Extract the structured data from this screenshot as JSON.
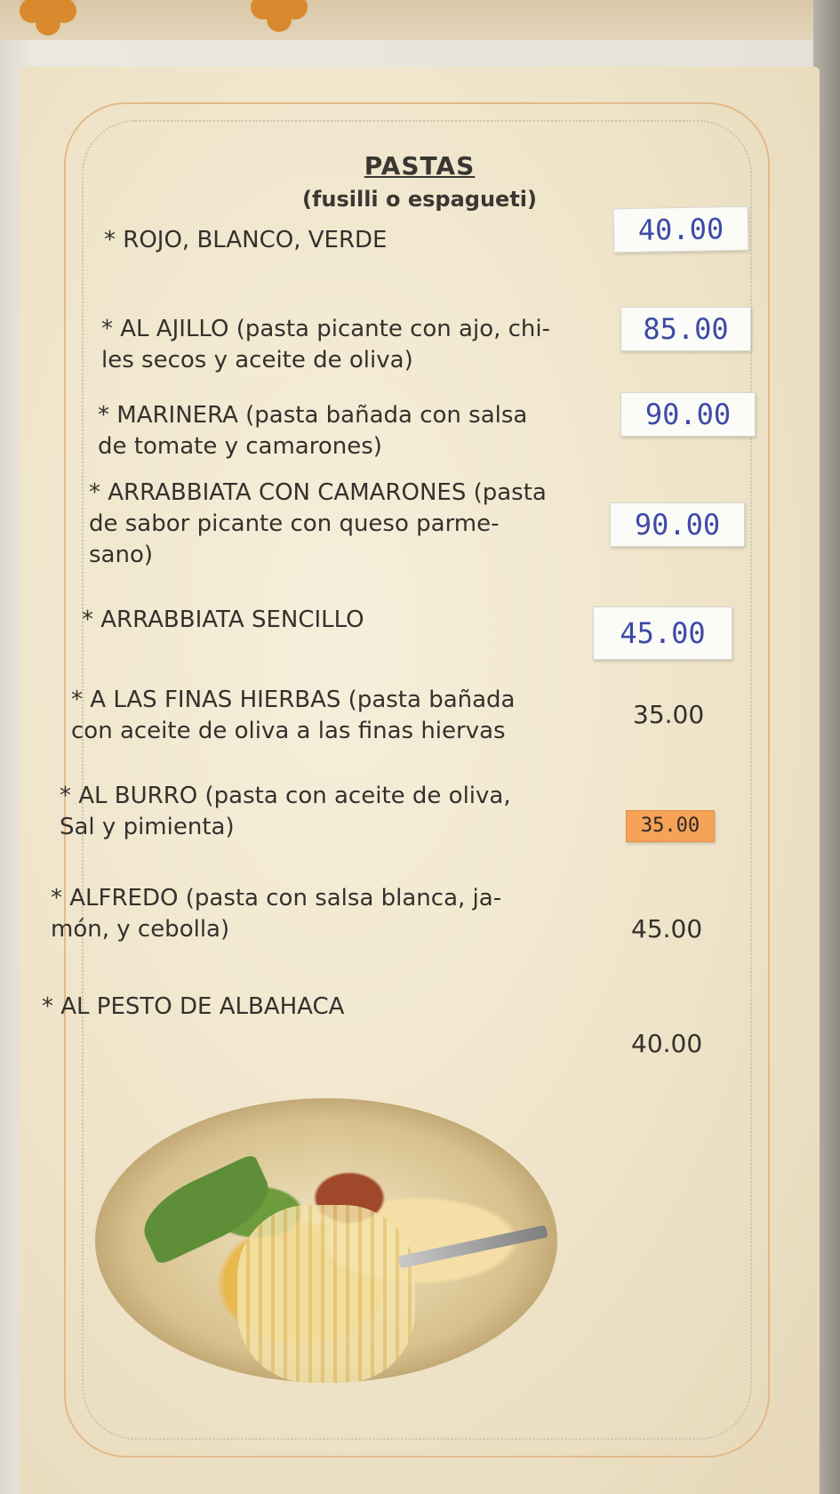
{
  "menu": {
    "title": "PASTAS",
    "subtitle": "(fusilli o espagueti)",
    "items": [
      {
        "line1": "* ROJO, BLANCO, VERDE",
        "line2": "",
        "line3": "",
        "price": "40.00"
      },
      {
        "line1": "* AL AJILLO (pasta picante con ajo, chi-",
        "line2": "les secos y aceite de oliva)",
        "line3": "",
        "price": "85.00"
      },
      {
        "line1": "* MARINERA (pasta bañada con salsa",
        "line2": "de tomate y camarones)",
        "line3": "",
        "price": "90.00"
      },
      {
        "line1": "* ARRABBIATA CON CAMARONES (pasta",
        "line2": "de sabor picante con queso parme-",
        "line3": "sano)",
        "price": "90.00"
      },
      {
        "line1": "* ARRABBIATA SENCILLO",
        "line2": "",
        "line3": "",
        "price": "45.00"
      },
      {
        "line1": "* A LAS FINAS HIERBAS (pasta bañada",
        "line2": "con aceite de oliva a las finas hiervas",
        "line3": "",
        "price": "35.00"
      },
      {
        "line1": "* AL BURRO (pasta con aceite de oliva,",
        "line2": "Sal y pimienta)",
        "line3": "",
        "price": "35.00"
      },
      {
        "line1": "* ALFREDO (pasta con salsa blanca, ja-",
        "line2": "món, y cebolla)",
        "line3": "",
        "price": "45.00"
      },
      {
        "line1": "* AL PESTO DE ALBAHACA",
        "line2": "",
        "line3": "",
        "price": "40.00"
      }
    ]
  }
}
